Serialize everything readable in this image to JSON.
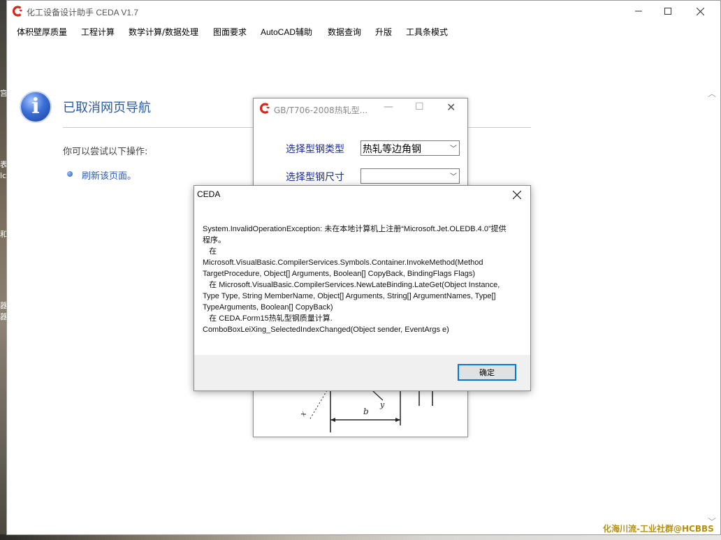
{
  "app": {
    "title": "化工设备设计助手 CEDA V1.7"
  },
  "menu": {
    "items": [
      "体积壁厚质量",
      "工程计算",
      "数学计算/数据处理",
      "图面要求",
      "AutoCAD辅助",
      "数据查询",
      "升版",
      "工具条模式"
    ]
  },
  "browser": {
    "title": "已取消网页导航",
    "try_text": "你可以尝试以下操作:",
    "refresh_link": "刷新该页面。"
  },
  "sub_window": {
    "title": "GB/T706-2008热轧型...",
    "type_label": "选择型钢类型",
    "type_value": "热轧等边角钢",
    "size_label": "选择型钢尺寸",
    "size_value": ""
  },
  "dialog": {
    "title": "CEDA",
    "message": "System.InvalidOperationException: 未在本地计算机上注册“Microsoft.Jet.OLEDB.4.0”提供程序。\n   在\nMicrosoft.VisualBasic.CompilerServices.Symbols.Container.InvokeMethod(Method TargetProcedure, Object[] Arguments, Boolean[] CopyBack, BindingFlags Flags)\n   在 Microsoft.VisualBasic.CompilerServices.NewLateBinding.LateGet(Object Instance, Type Type, String MemberName, Object[] Arguments, String[] ArgumentNames, Type[] TypeArguments, Boolean[] CopyBack)\n   在 CEDA.Form15热轧型钢质量计算.\nComboBoxLeiXing_SelectedIndexChanged(Object sender, EventArgs e)",
    "ok_label": "确定"
  },
  "desktop": {
    "fragments": [
      "宫",
      "表",
      "lc",
      "和",
      "器",
      "器"
    ]
  },
  "watermark": "化海川流-工业社群@HCBBS",
  "colors": {
    "accent": "#0078d7",
    "brand_red": "#d9261c",
    "link": "#2a5bb5"
  },
  "icons": [
    "ceda-logo-icon",
    "minimize-icon",
    "maximize-icon",
    "close-icon",
    "info-icon",
    "bullet-icon",
    "chevron-down-icon",
    "scroll-up-icon",
    "scroll-down-icon"
  ]
}
